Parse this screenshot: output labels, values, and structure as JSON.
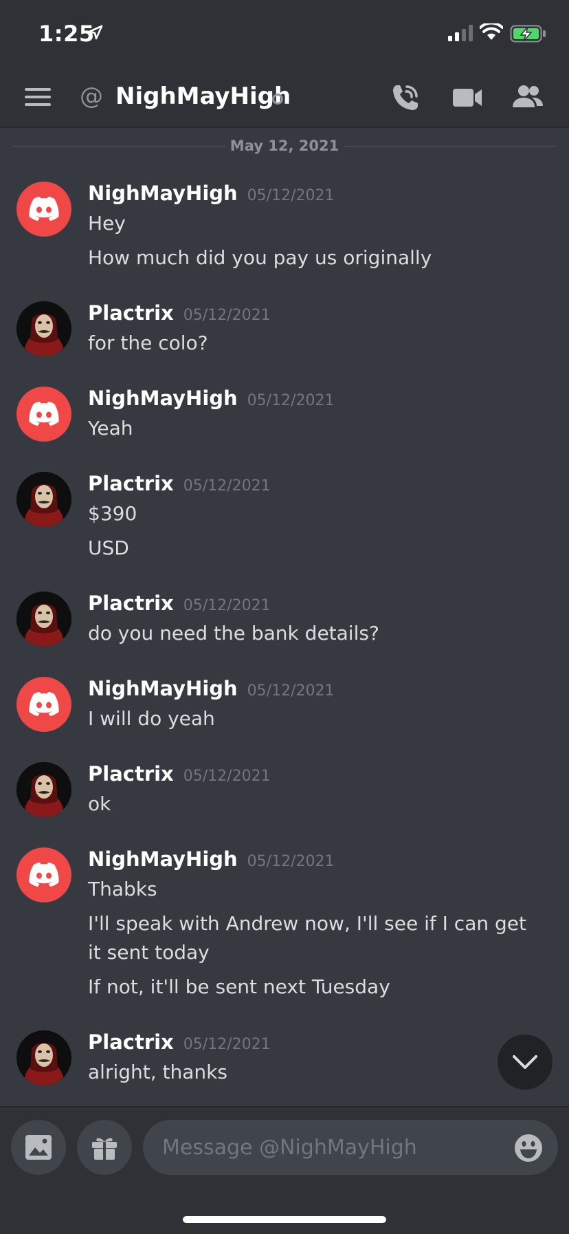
{
  "status_bar": {
    "time": "1:25"
  },
  "header": {
    "at_symbol": "@",
    "dm_name": "NighMayHigh"
  },
  "date_divider": "May 12, 2021",
  "messages": [
    {
      "author": "NighMayHigh",
      "timestamp": "05/12/2021",
      "avatar": "discord-logo",
      "lines": [
        "Hey",
        "How much did you pay us originally"
      ]
    },
    {
      "author": "Plactrix",
      "timestamp": "05/12/2021",
      "avatar": "masked-figure",
      "lines": [
        "for the colo?"
      ]
    },
    {
      "author": "NighMayHigh",
      "timestamp": "05/12/2021",
      "avatar": "discord-logo",
      "lines": [
        "Yeah"
      ]
    },
    {
      "author": "Plactrix",
      "timestamp": "05/12/2021",
      "avatar": "masked-figure",
      "lines": [
        "$390",
        "USD"
      ]
    },
    {
      "author": "Plactrix",
      "timestamp": "05/12/2021",
      "avatar": "masked-figure",
      "lines": [
        "do you need the bank details?"
      ]
    },
    {
      "author": "NighMayHigh",
      "timestamp": "05/12/2021",
      "avatar": "discord-logo",
      "lines": [
        "I will do yeah"
      ]
    },
    {
      "author": "Plactrix",
      "timestamp": "05/12/2021",
      "avatar": "masked-figure",
      "lines": [
        "ok"
      ]
    },
    {
      "author": "NighMayHigh",
      "timestamp": "05/12/2021",
      "avatar": "discord-logo",
      "lines": [
        "Thabks",
        "I'll speak with Andrew now, I'll see if I can get it sent today",
        "If not, it'll be sent next Tuesday"
      ]
    },
    {
      "author": "Plactrix",
      "timestamp": "05/12/2021",
      "avatar": "masked-figure",
      "lines": [
        "alright, thanks"
      ]
    }
  ],
  "composer": {
    "placeholder": "Message @NighMayHigh"
  },
  "colors": {
    "background": "#36393f",
    "header": "#2f3136",
    "discord_red": "#f04747",
    "battery_green": "#4cd964"
  }
}
